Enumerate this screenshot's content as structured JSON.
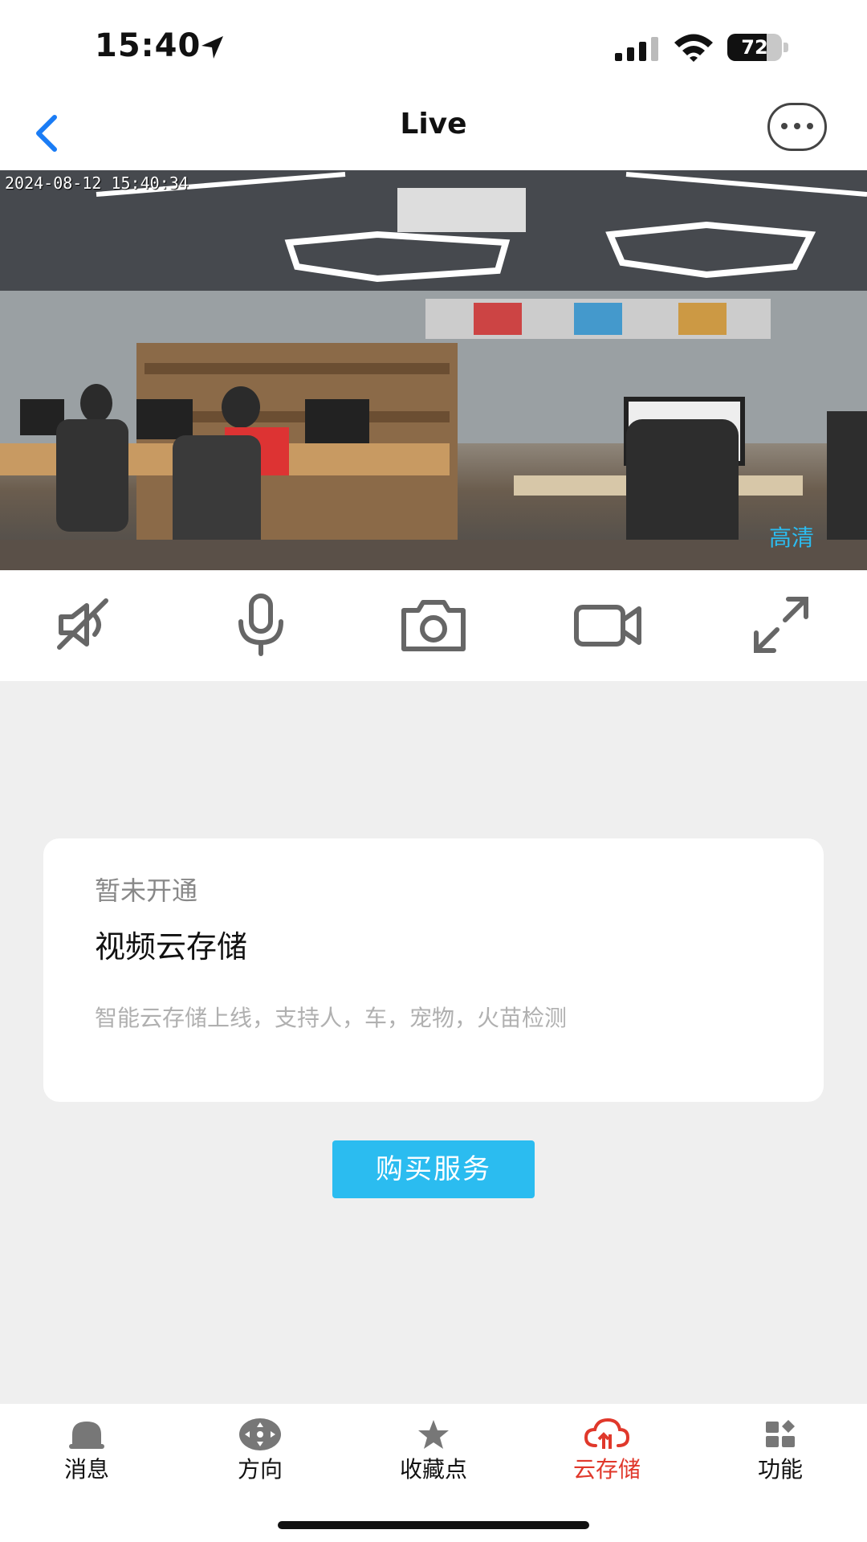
{
  "status_bar": {
    "time": "15:40",
    "battery_level": "72",
    "battery_fraction": 0.72
  },
  "nav": {
    "title": "Live"
  },
  "video": {
    "timestamp": "2024-08-12 15:40:34",
    "quality": "高清"
  },
  "card": {
    "status": "暂未开通",
    "title": "视频云存储",
    "description": "智能云存储上线，支持人，车，宠物，火苗检测"
  },
  "buy_button": {
    "label": "购买服务"
  },
  "tabs": [
    {
      "label": "消息",
      "icon": "bell-icon"
    },
    {
      "label": "方向",
      "icon": "direction-pad-icon"
    },
    {
      "label": "收藏点",
      "icon": "star-icon"
    },
    {
      "label": "云存储",
      "icon": "cloud-storage-icon",
      "active": true
    },
    {
      "label": "功能",
      "icon": "apps-icon"
    }
  ],
  "colors": {
    "accent": "#2bbcf0",
    "active_tab": "#e0382b",
    "back": "#1a7cf5"
  }
}
